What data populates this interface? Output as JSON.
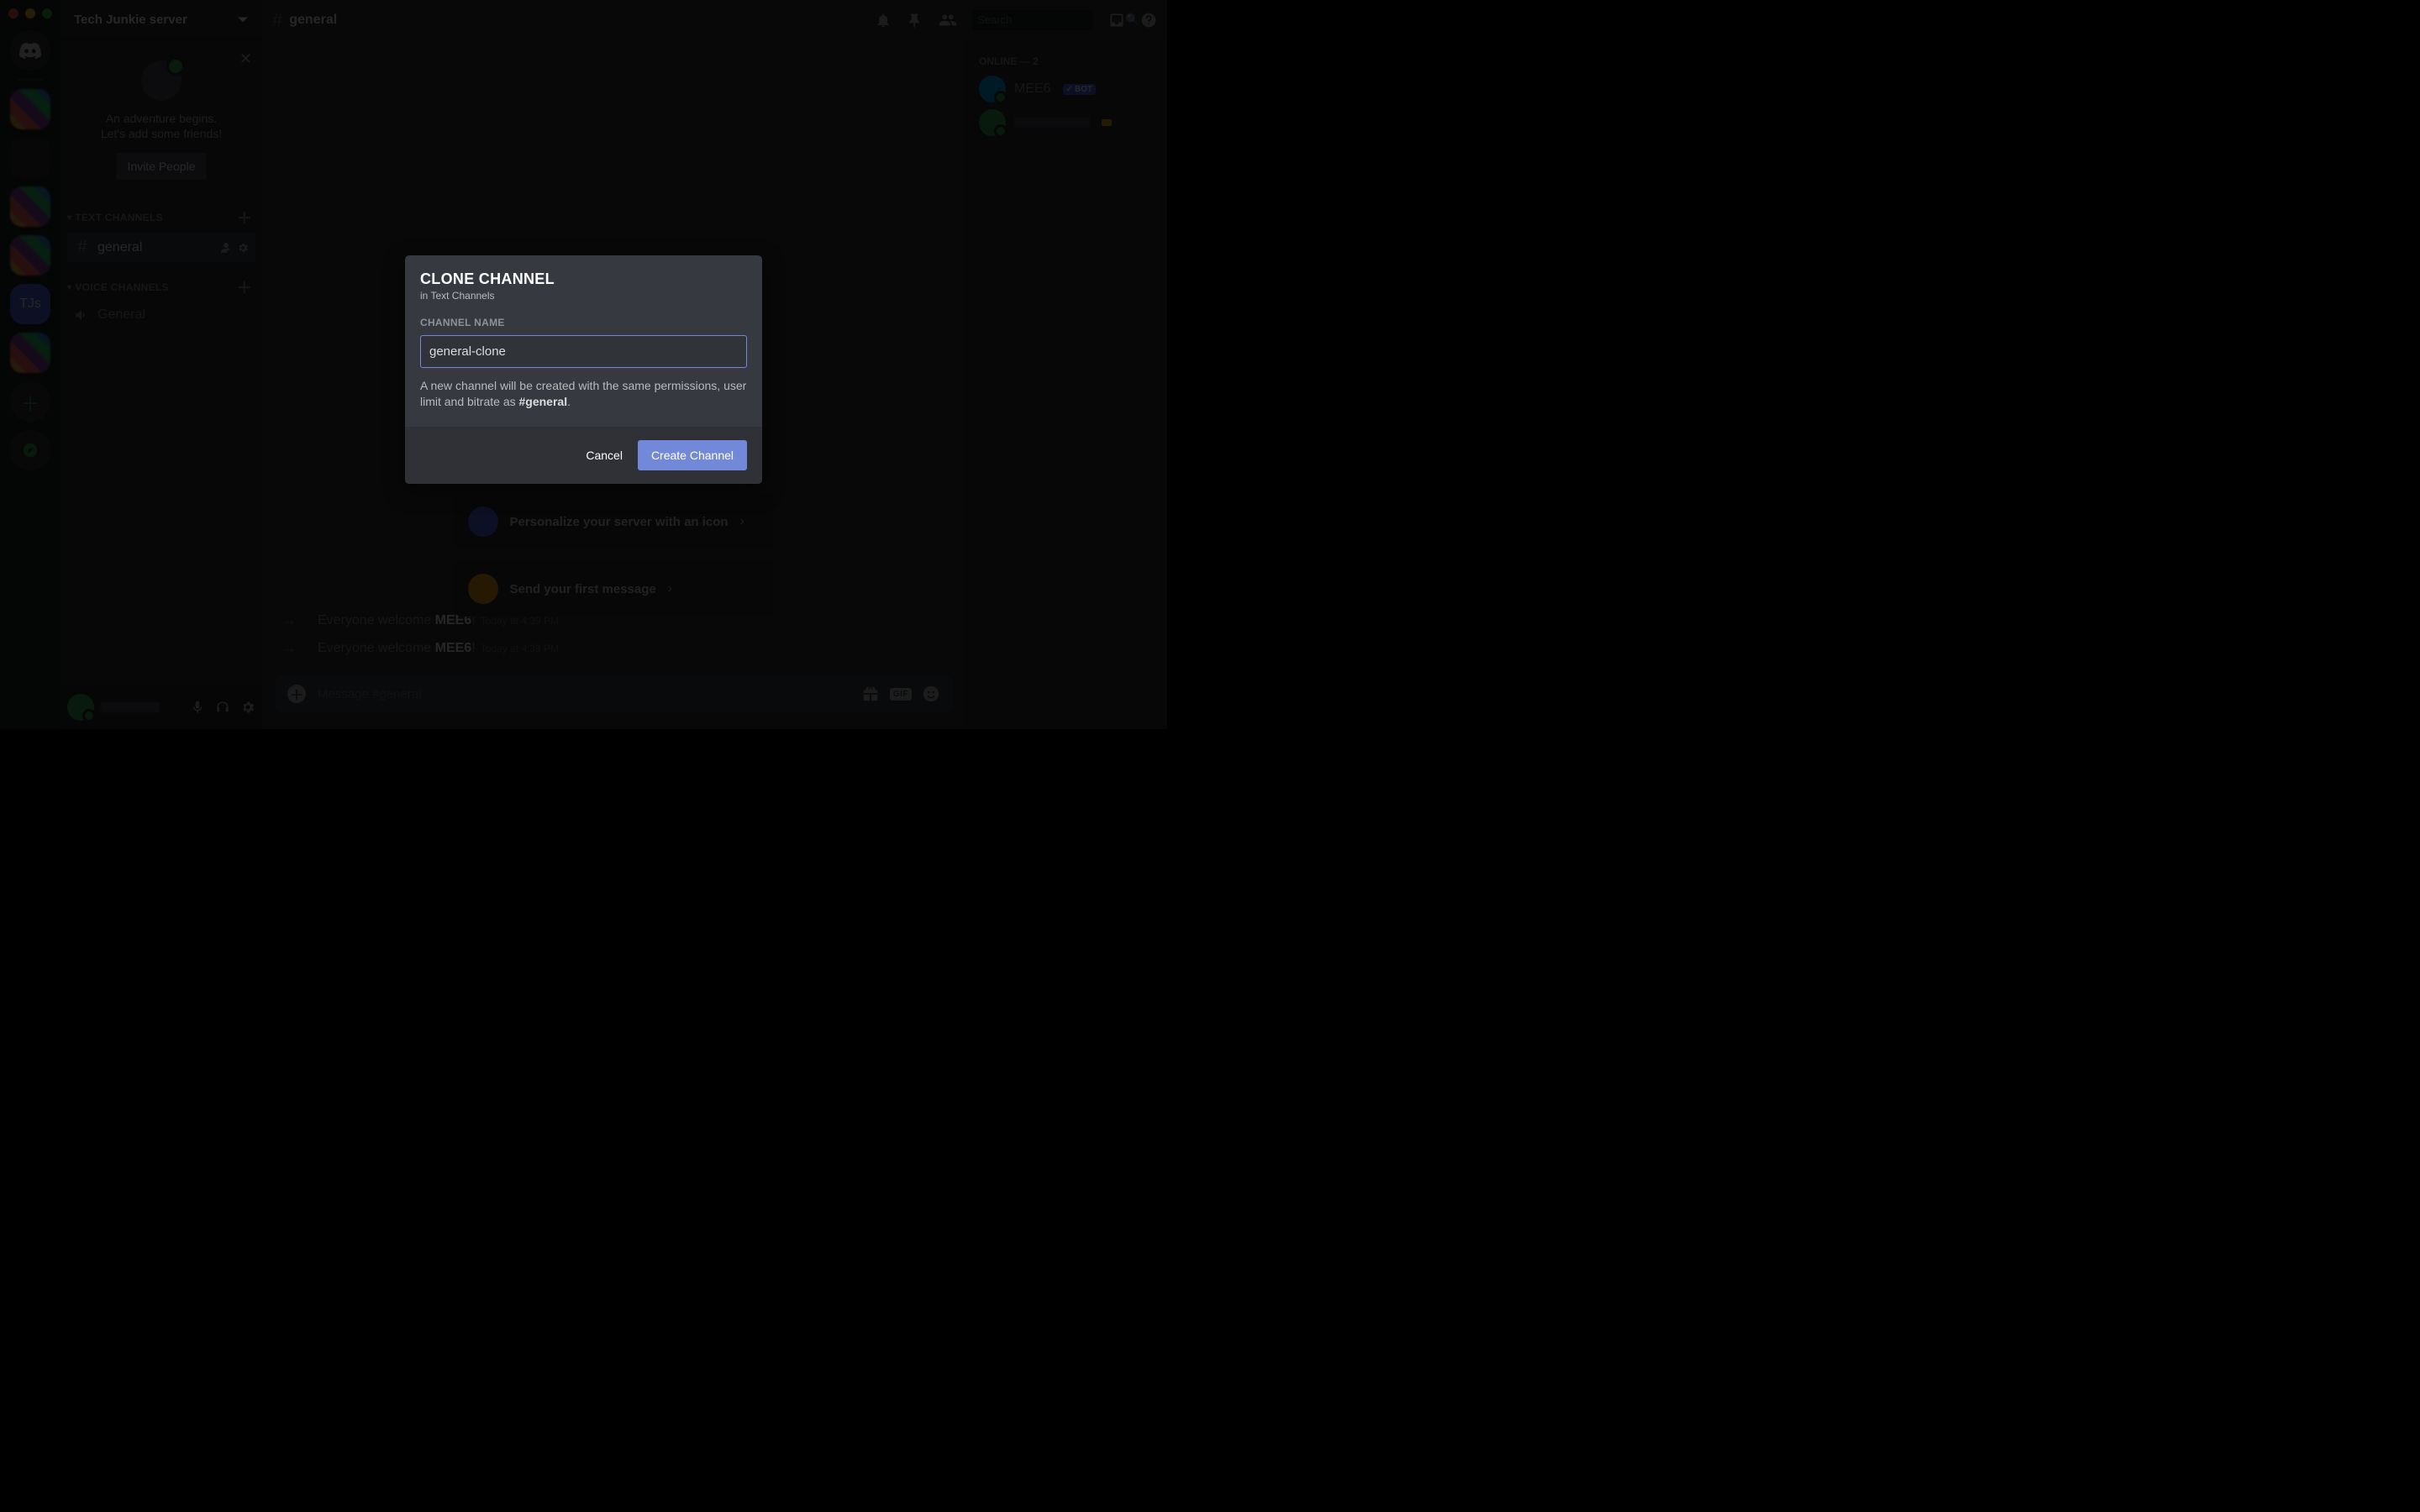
{
  "window": {
    "server_name": "Tech Junkie server",
    "channel_hash": "#",
    "channel_name": "general"
  },
  "server_rail": {
    "home_label": "discord",
    "tjs_label": "TJs"
  },
  "welcome": {
    "title": "An adventure begins.",
    "subtitle": "Let's add some friends!",
    "invite_label": "Invite People"
  },
  "categories": {
    "text": {
      "label": "TEXT CHANNELS",
      "channels": [
        {
          "name": "general",
          "active": true
        }
      ]
    },
    "voice": {
      "label": "VOICE CHANNELS",
      "channels": [
        {
          "name": "General"
        }
      ]
    }
  },
  "header_icons": {
    "search_placeholder": "Search"
  },
  "onboarding": {
    "card1": "Personalize your server with an icon",
    "card2": "Send your first message"
  },
  "messages": [
    {
      "prefix": "Everyone welcome ",
      "name": "MEE6",
      "suffix": "!",
      "timestamp": "Today at 4:39 PM"
    },
    {
      "prefix": "Everyone welcome ",
      "name": "MEE6",
      "suffix": "!",
      "timestamp": "Today at 4:39 PM"
    }
  ],
  "message_input": {
    "placeholder": "Message #general",
    "gif_label": "GIF"
  },
  "members": {
    "header": "ONLINE — 2",
    "list": [
      {
        "name": "MEE6",
        "bot": true,
        "bot_label": "BOT"
      }
    ]
  },
  "modal": {
    "title": "CLONE CHANNEL",
    "subtitle": "in Text Channels",
    "input_label": "CHANNEL NAME",
    "input_value": "general-clone",
    "help_pre": "A new channel will be created with the same permissions, user limit and bitrate as ",
    "help_bold": "#general",
    "help_post": ".",
    "cancel_label": "Cancel",
    "confirm_label": "Create Channel"
  }
}
